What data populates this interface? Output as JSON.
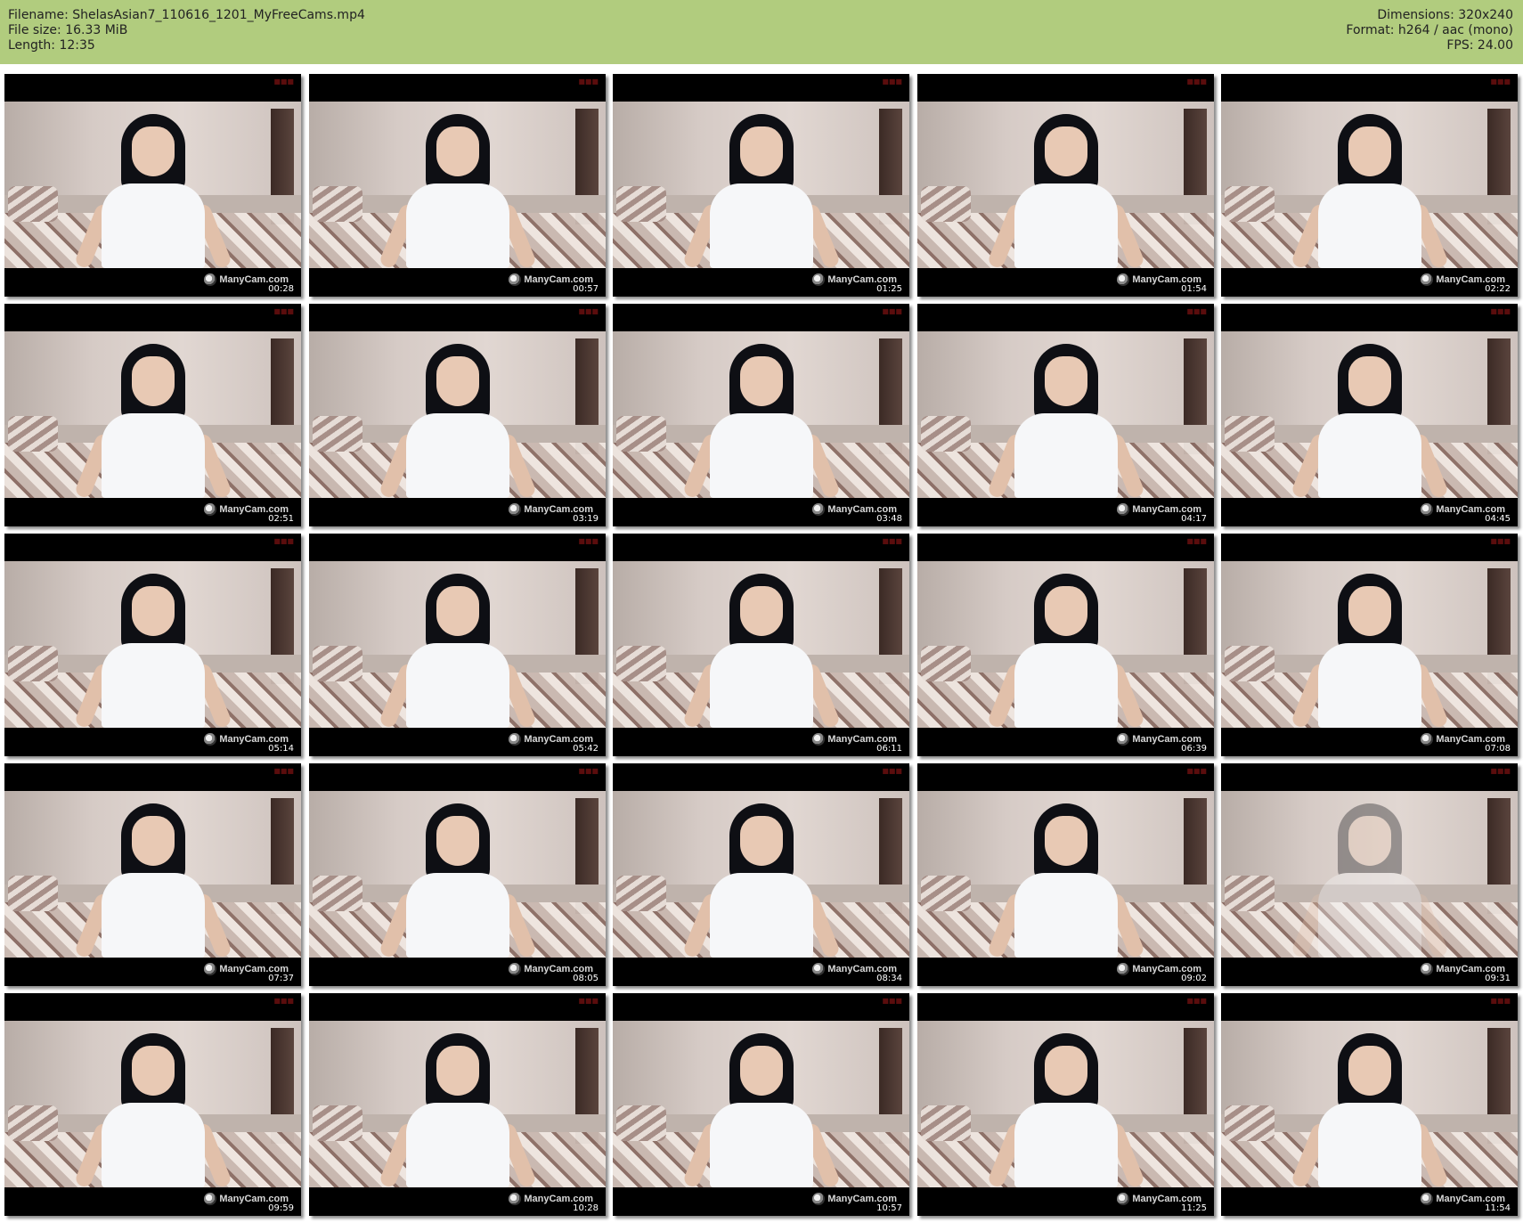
{
  "header": {
    "filename": "Filename: ShelasAsian7_110616_1201_MyFreeCams.mp4",
    "file_size": "File size: 16.33 MiB",
    "length": "Length: 12:35",
    "dimensions": "Dimensions: 320x240",
    "format": "Format: h264 / aac (mono)",
    "fps": "FPS: 24.00"
  },
  "colors": {
    "header_bg": "#b1cc7e"
  },
  "thumbnails": [
    {
      "time": "00:28",
      "logo_text": "ManyCam.com"
    },
    {
      "time": "00:57",
      "logo_text": "ManyCam.com"
    },
    {
      "time": "01:25",
      "logo_text": "ManyCam.com"
    },
    {
      "time": "01:54",
      "logo_text": "ManyCam.com"
    },
    {
      "time": "02:22",
      "logo_text": "ManyCam.com"
    },
    {
      "time": "02:51",
      "logo_text": "ManyCam.com"
    },
    {
      "time": "03:19",
      "logo_text": "ManyCam.com"
    },
    {
      "time": "03:48",
      "logo_text": "ManyCam.com"
    },
    {
      "time": "04:17",
      "logo_text": "ManyCam.com"
    },
    {
      "time": "04:45",
      "logo_text": "ManyCam.com"
    },
    {
      "time": "05:14",
      "logo_text": "ManyCam.com"
    },
    {
      "time": "05:42",
      "logo_text": "ManyCam.com"
    },
    {
      "time": "06:11",
      "logo_text": "ManyCam.com"
    },
    {
      "time": "06:39",
      "logo_text": "ManyCam.com"
    },
    {
      "time": "07:08",
      "logo_text": "ManyCam.com"
    },
    {
      "time": "07:37",
      "logo_text": "ManyCam.com"
    },
    {
      "time": "08:05",
      "logo_text": "ManyCam.com"
    },
    {
      "time": "08:34",
      "logo_text": "ManyCam.com"
    },
    {
      "time": "09:02",
      "logo_text": "ManyCam.com"
    },
    {
      "time": "09:31",
      "logo_text": "ManyCam.com"
    },
    {
      "time": "09:59",
      "logo_text": "ManyCam.com"
    },
    {
      "time": "10:28",
      "logo_text": "ManyCam.com"
    },
    {
      "time": "10:57",
      "logo_text": "ManyCam.com"
    },
    {
      "time": "11:25",
      "logo_text": "ManyCam.com"
    },
    {
      "time": "11:54",
      "logo_text": "ManyCam.com"
    }
  ]
}
